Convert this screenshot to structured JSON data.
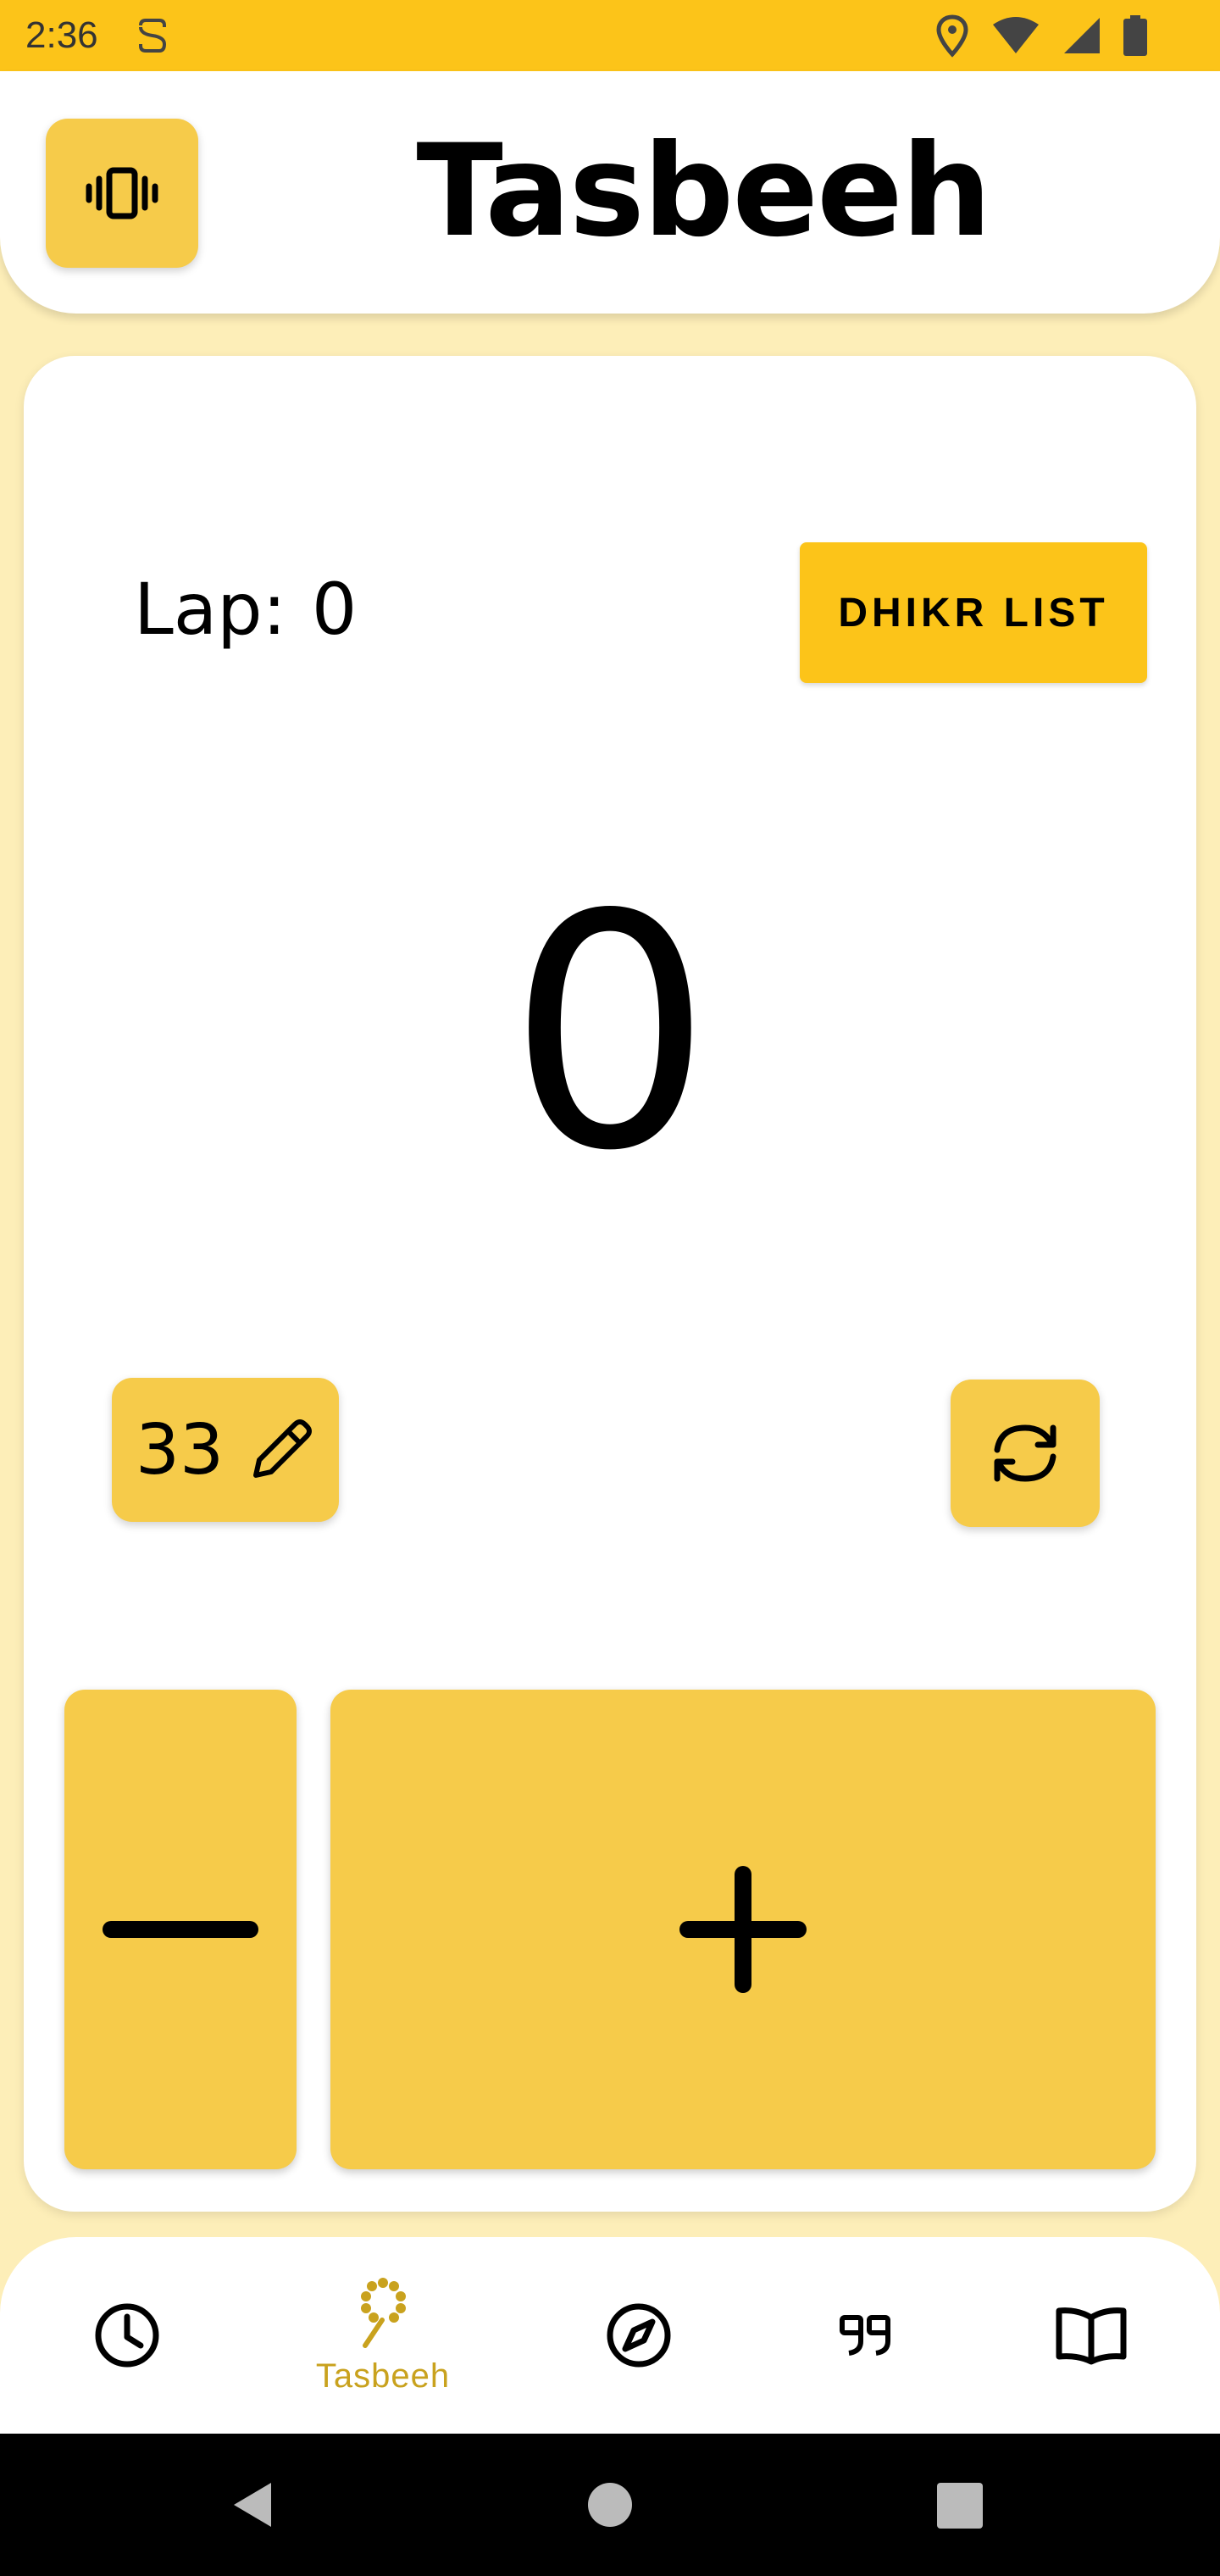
{
  "status_bar": {
    "time": "2:36",
    "icons": [
      "s-notification-icon",
      "location-icon",
      "wifi-icon",
      "signal-icon",
      "battery-icon"
    ]
  },
  "header": {
    "title": "Tasbeeh",
    "vibrate_icon": "vibrate-icon"
  },
  "counter_card": {
    "lap_label": "Lap:",
    "lap_value": "0",
    "dhikr_list_label": "DHIKR LIST",
    "count": "0",
    "target": "33",
    "edit_icon": "pencil-icon",
    "reset_icon": "refresh-icon",
    "decrement_icon": "minus-icon",
    "increment_icon": "plus-icon"
  },
  "bottom_nav": {
    "items": [
      {
        "icon": "clock-icon",
        "label": ""
      },
      {
        "icon": "tasbeeh-icon",
        "label": "Tasbeeh",
        "active": true
      },
      {
        "icon": "compass-icon",
        "label": ""
      },
      {
        "icon": "quote-icon",
        "label": ""
      },
      {
        "icon": "book-icon",
        "label": ""
      }
    ]
  },
  "colors": {
    "accent": "#fcc419",
    "button": "#f6cb4a",
    "background": "#fdeeb8",
    "active_label": "#c9a21e"
  }
}
